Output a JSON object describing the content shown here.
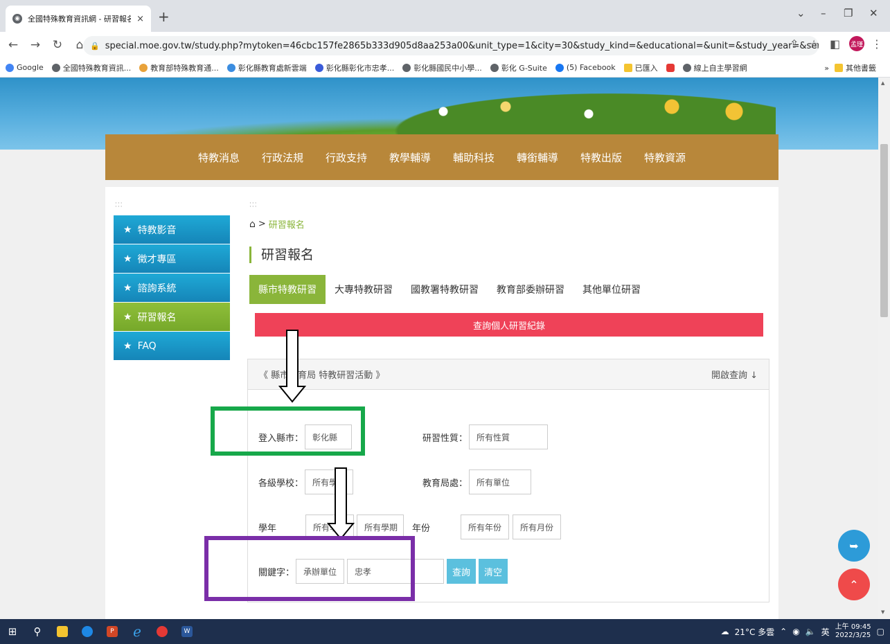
{
  "browser": {
    "tab_title": "全國特殊教育資訊網 - 研習報名",
    "tab_close": "×",
    "new_tab": "+",
    "url": "special.moe.gov.tw/study.php?mytoken=46cbc157fe2865b333d905d8aa253a00&unit_type=1&city=30&study_kind=&educational=&unit=&study_year=&semester=&year=&m...",
    "profile_label": "孟瑾",
    "bookmarks": [
      {
        "label": "Google",
        "color": "#4285f4"
      },
      {
        "label": "全國特殊教育資訊...",
        "color": "#5f6368"
      },
      {
        "label": "教育部特殊教育通...",
        "color": "#e8a23a"
      },
      {
        "label": "彰化縣教育處新雲端",
        "color": "#3b8de0"
      },
      {
        "label": "彰化縣彰化市忠孝...",
        "color": "#3a5bd9"
      },
      {
        "label": "彰化縣國民中小學...",
        "color": "#5f6368"
      },
      {
        "label": "彰化 G-Suite",
        "color": "#5f6368"
      },
      {
        "label": "(5) Facebook",
        "color": "#1877f2"
      },
      {
        "label": "已匯入",
        "color": "#f4c430"
      },
      {
        "label": "",
        "color": "#e53935"
      },
      {
        "label": "線上自主學習網",
        "color": "#5f6368"
      }
    ],
    "bookmarks_more": "»",
    "other_bookmarks": "其他書籤"
  },
  "nav": {
    "items": [
      "特教消息",
      "行政法規",
      "行政支持",
      "教學輔導",
      "輔助科技",
      "轉銜輔導",
      "特教出版",
      "特教資源"
    ]
  },
  "sidebar": {
    "items": [
      {
        "label": "特教影音",
        "active": false
      },
      {
        "label": "徵才專區",
        "active": false
      },
      {
        "label": "諮詢系統",
        "active": false
      },
      {
        "label": "研習報名",
        "active": true
      },
      {
        "label": "FAQ",
        "active": false
      }
    ]
  },
  "breadcrumb": {
    "separator": ">",
    "current": "研習報名"
  },
  "page_title": "研習報名",
  "tabs": [
    {
      "label": "縣市特教研習",
      "active": true
    },
    {
      "label": "大專特教研習",
      "active": false
    },
    {
      "label": "國教署特教研習",
      "active": false
    },
    {
      "label": "教育部委辦研習",
      "active": false
    },
    {
      "label": "其他單位研習",
      "active": false
    }
  ],
  "record_button": "查詢個人研習紀錄",
  "panel": {
    "title": "《 縣市教育局 特教研習活動 》",
    "toggle": "開啟查詢 ↓"
  },
  "filters": {
    "city_label": "登入縣市：",
    "city_value": "彰化縣",
    "nature_label": "研習性質：",
    "nature_value": "所有性質",
    "school_label": "各級學校：",
    "school_value": "所有學校",
    "bureau_label": "教育局處：",
    "bureau_value": "所有單位",
    "year_label": "學年",
    "school_year_value": "所有學年",
    "semester_value": "所有學期",
    "yearfen_label": "年份",
    "year_value": "所有年份",
    "month_value": "所有月份",
    "keyword_label": "關鍵字：",
    "keyword_type": "承辦單位",
    "keyword_value": "忠孝",
    "search_button": "查詢",
    "clear_button": "清空"
  },
  "annotations": {
    "green": "#17a84a",
    "purple": "#7a2ea8"
  },
  "taskbar": {
    "weather": "21°C 多雲",
    "ime": "英",
    "time": "上午 09:45",
    "date": "2022/3/25"
  }
}
